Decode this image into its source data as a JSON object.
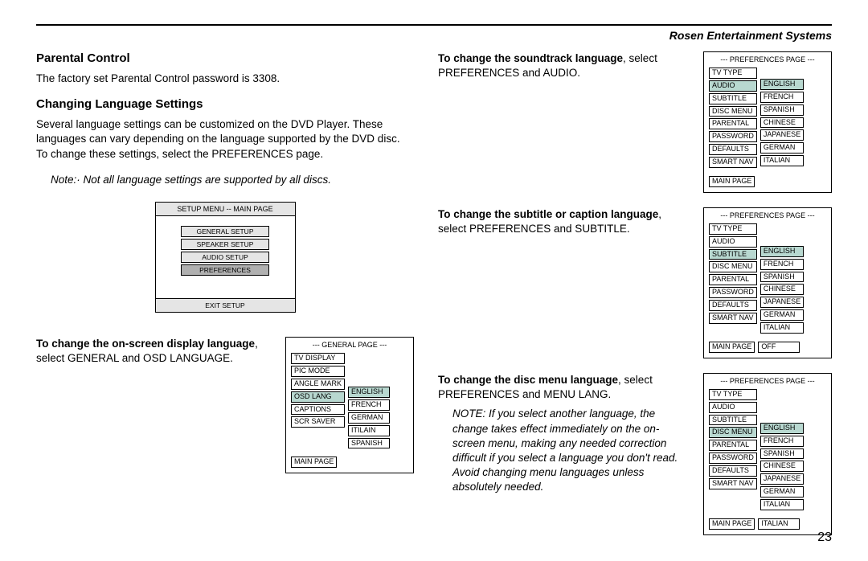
{
  "brand": "Rosen Entertainment Systems",
  "left": {
    "h1": "Parental Control",
    "p1": "The factory set Parental Control password is 3308.",
    "h2": "Changing Language Settings",
    "p2": "Several language settings can be customized on the DVD Player. These languages can vary depending on the language supported by the DVD disc. To change these settings, select the PREFERENCES page.",
    "note": "Note:· Not all language settings are supported by all discs.",
    "setup": {
      "title": "SETUP MENU -- MAIN PAGE",
      "items": [
        "GENERAL SETUP",
        "SPEAKER SETUP",
        "AUDIO SETUP",
        "PREFERENCES"
      ],
      "selected": 3,
      "footer": "EXIT SETUP"
    },
    "osd_bold": "To change the on-screen display language",
    "osd_rest": ", select GENERAL and OSD LANGUAGE.",
    "general_menu": {
      "title": "--- GENERAL PAGE ---",
      "col1": [
        "TV DISPLAY",
        "PIC MODE",
        "ANGLE MARK",
        "OSD LANG",
        "CAPTIONS",
        "SCR SAVER"
      ],
      "selected1": 3,
      "col2": [
        "ENGLISH",
        "FRENCH",
        "GERMAN",
        "ITILAIN",
        "SPANISH"
      ],
      "selected2": 0,
      "footer1": "MAIN PAGE"
    }
  },
  "right": {
    "audio_bold": "To change the soundtrack language",
    "audio_rest": ", select PREFERENCES and AUDIO.",
    "audio_menu": {
      "title": "--- PREFERENCES PAGE ---",
      "col1": [
        "TV TYPE",
        "AUDIO",
        "SUBTITLE",
        "DISC MENU",
        "PARENTAL",
        "PASSWORD",
        "DEFAULTS",
        "SMART NAV"
      ],
      "selected1": 1,
      "col2": [
        "ENGLISH",
        "FRENCH",
        "SPANISH",
        "CHINESE",
        "JAPANESE",
        "GERMAN",
        "ITALIAN"
      ],
      "selected2": 0,
      "footer1": "MAIN PAGE"
    },
    "sub_bold": "To change the subtitle or caption language",
    "sub_rest": ", select PREFERENCES and SUBTITLE.",
    "sub_menu": {
      "title": "--- PREFERENCES PAGE ---",
      "col1": [
        "TV TYPE",
        "AUDIO",
        "SUBTITLE",
        "DISC MENU",
        "PARENTAL",
        "PASSWORD",
        "DEFAULTS",
        "SMART NAV"
      ],
      "selected1": 2,
      "col2": [
        "ENGLISH",
        "FRENCH",
        "SPANISH",
        "CHINESE",
        "JAPANESE",
        "GERMAN",
        "ITALIAN"
      ],
      "selected2": 0,
      "footer1": "MAIN PAGE",
      "footer2": "OFF"
    },
    "disc_bold": "To change the disc menu language",
    "disc_rest": ", select PREFERENCES and MENU LANG.",
    "disc_note": "NOTE: If you select another language, the change takes effect immediately on the on-screen menu, making any needed correction difficult if you select a language you don't read. Avoid changing menu languages unless absolutely needed.",
    "disc_menu": {
      "title": "--- PREFERENCES PAGE ---",
      "col1": [
        "TV TYPE",
        "AUDIO",
        "SUBTITLE",
        "DISC MENU",
        "PARENTAL",
        "PASSWORD",
        "DEFAULTS",
        "SMART NAV"
      ],
      "selected1": 3,
      "col2": [
        "ENGLISH",
        "FRENCH",
        "SPANISH",
        "CHINESE",
        "JAPANESE",
        "GERMAN",
        "ITALIAN"
      ],
      "selected2": 0,
      "footer1": "MAIN PAGE",
      "footer2": "ITALIAN"
    }
  },
  "pagenum": "23"
}
